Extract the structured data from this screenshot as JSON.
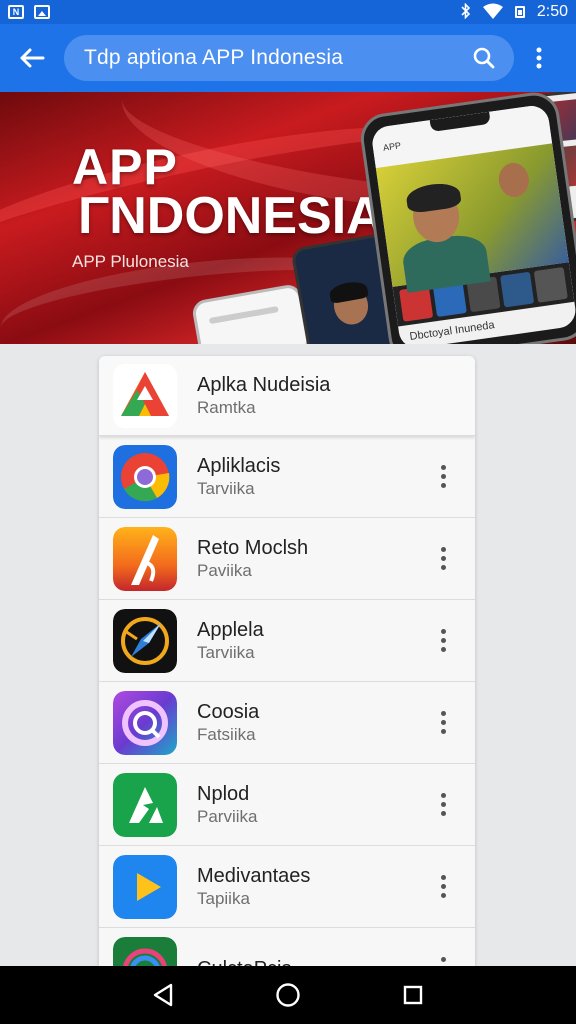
{
  "status_bar": {
    "time": "2:50",
    "left_icons": [
      "n-notification-icon",
      "image-notification-icon"
    ],
    "right_icons": [
      "bluetooth-icon",
      "wifi-icon",
      "battery-icon"
    ]
  },
  "app_bar": {
    "back_icon": "arrow-left-icon",
    "search_text": "Tdp aptiona APP  Indonesia",
    "search_icon": "search-icon",
    "overflow_icon": "more-vert-icon",
    "color": "#1e73e8"
  },
  "banner": {
    "title_line1": "APP",
    "title_line2": "ΓNDONESIA",
    "subtitle": "APP Plulonesia",
    "phone_caption": "Dbctoyal Inuneda",
    "phone_topbar": "APP"
  },
  "apps": [
    {
      "name": "Aplka Nudeisia",
      "sub": "Ramtka",
      "icon": "triangle-logo-icon",
      "has_menu": false
    },
    {
      "name": "Apliklacis",
      "sub": "Tarviika",
      "icon": "chrome-logo-icon",
      "has_menu": true
    },
    {
      "name": "Reto Moclsh",
      "sub": "Paviika",
      "icon": "orange-slash-logo-icon",
      "has_menu": true
    },
    {
      "name": "Applela",
      "sub": "Tarviika",
      "icon": "compass-logo-icon",
      "has_menu": true
    },
    {
      "name": "Coosia",
      "sub": "Fatsiika",
      "icon": "purple-ring-logo-icon",
      "has_menu": true
    },
    {
      "name": "Nplod",
      "sub": "Parviika",
      "icon": "green-a-logo-icon",
      "has_menu": true
    },
    {
      "name": "Medivantaes",
      "sub": "Tapiika",
      "icon": "play-logo-icon",
      "has_menu": true
    },
    {
      "name": "CulctaPcis",
      "sub": "",
      "icon": "rainbow-ring-logo-icon",
      "has_menu": true
    }
  ],
  "nav": {
    "back_icon": "nav-back-icon",
    "home_icon": "nav-home-icon",
    "recents_icon": "nav-recents-icon"
  }
}
